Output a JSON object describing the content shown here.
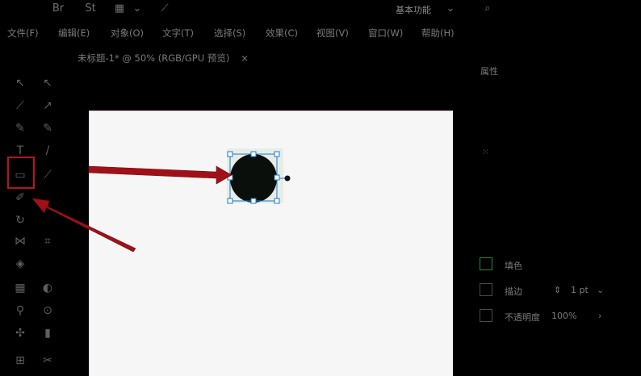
{
  "topbar": {
    "icons": [
      "bridge-icon",
      "stock-icon",
      "layout-icon",
      "chevron-down-icon",
      "brush-icon"
    ],
    "workspace_label": "基本功能",
    "search_icon": "search-icon"
  },
  "menu": {
    "items": [
      "文件(F)",
      "编辑(E)",
      "对象(O)",
      "文字(T)",
      "选择(S)",
      "效果(C)",
      "视图(V)",
      "窗口(W)",
      "帮助(H)"
    ]
  },
  "document_tab": {
    "title": "未标题-1* @ 50% (RGB/GPU 预览)",
    "close": "×"
  },
  "annotation": {
    "highlight_color": "#b3161c",
    "arrow_color": "#a01018"
  },
  "right_panel": {
    "title": "属性",
    "fill_label": "填色",
    "stroke_label": "描边",
    "stroke_value": "1 pt",
    "opacity_label": "不透明度",
    "opacity_value": "100%"
  },
  "colors": {
    "fill": "#0b0f0b",
    "selection": "#1e78c8",
    "fill_swatch": "#2a8a2a"
  }
}
